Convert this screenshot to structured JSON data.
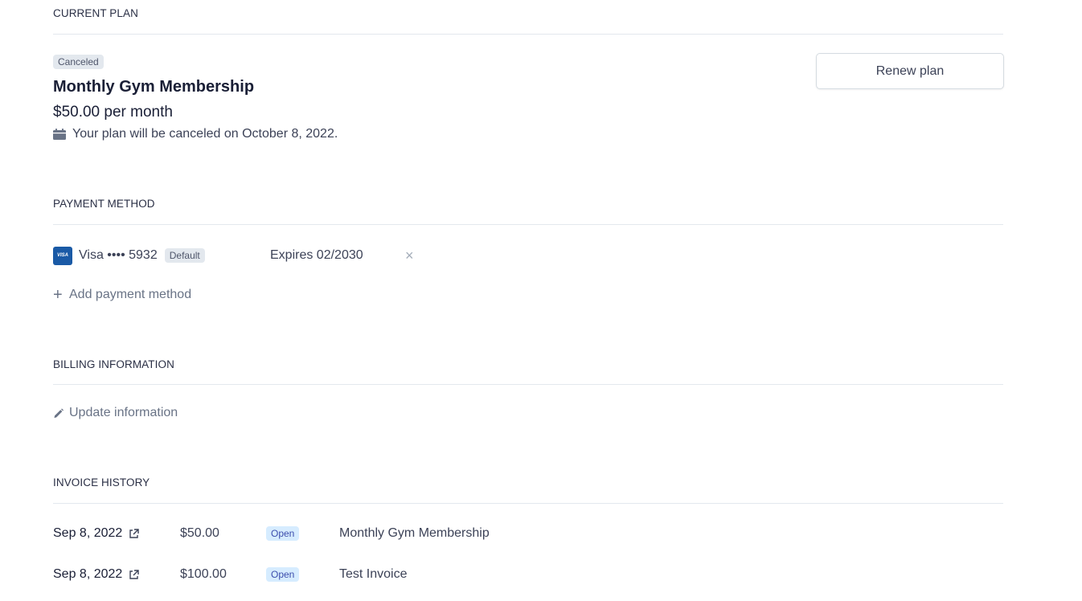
{
  "current_plan": {
    "heading": "CURRENT PLAN",
    "status_badge": "Canceled",
    "name": "Monthly Gym Membership",
    "price": "$50.00 per month",
    "cancel_note": "Your plan will be canceled on October 8, 2022.",
    "renew_label": "Renew plan",
    "note_icon": "calendar-icon"
  },
  "payment_method": {
    "heading": "PAYMENT METHOD",
    "card_brand_logo": "VISA",
    "card_label": "Visa •••• 5932",
    "default_badge": "Default",
    "expires": "Expires 02/2030",
    "remove_glyph": "×",
    "add_label": "Add payment method",
    "add_glyph": "+"
  },
  "billing_information": {
    "heading": "BILLING INFORMATION",
    "update_label": "Update information",
    "update_icon": "pencil-icon"
  },
  "invoice_history": {
    "heading": "INVOICE HISTORY",
    "rows": [
      {
        "date": "Sep 8, 2022",
        "amount": "$50.00",
        "status": "Open",
        "description": "Monthly Gym Membership"
      },
      {
        "date": "Sep 8, 2022",
        "amount": "$100.00",
        "status": "Open",
        "description": "Test Invoice"
      }
    ]
  },
  "colors": {
    "text_primary": "#1a1f36",
    "text_muted": "#697386",
    "divider": "#e3e8ee",
    "open_badge_bg": "#d6ecff",
    "visa_blue": "#1a5aa6"
  }
}
